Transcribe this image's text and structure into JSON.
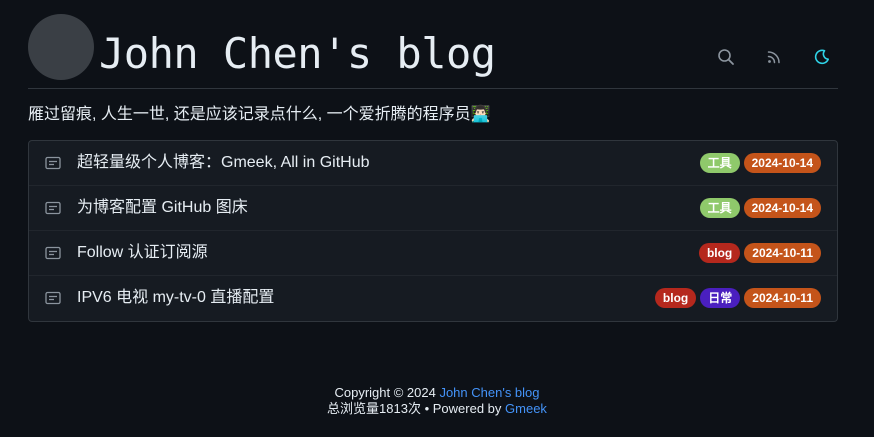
{
  "header": {
    "title": "John Chen's blog",
    "icons": [
      {
        "name": "search-icon",
        "color": "#8b949e"
      },
      {
        "name": "rss-icon",
        "color": "#8b949e"
      },
      {
        "name": "moon-icon",
        "color": "#2fd4e8"
      }
    ]
  },
  "subtitle": "雁过留痕, 人生一世, 还是应该记录点什么, 一个爱折腾的程序员",
  "subtitle_emoji": "👨🏻‍💻",
  "posts": [
    {
      "title": "超轻量级个人博客：Gmeek, All in GitHub",
      "labels": [
        {
          "text": "工具",
          "color": "#8fc96b"
        },
        {
          "text": "2024-10-14",
          "color": "#c4541a"
        }
      ]
    },
    {
      "title": "为博客配置 GitHub 图床",
      "labels": [
        {
          "text": "工具",
          "color": "#8fc96b"
        },
        {
          "text": "2024-10-14",
          "color": "#c4541a"
        }
      ]
    },
    {
      "title": "Follow 认证订阅源",
      "labels": [
        {
          "text": "blog",
          "color": "#b5281d"
        },
        {
          "text": "2024-10-11",
          "color": "#c4541a"
        }
      ]
    },
    {
      "title": "IPV6 电视 my-tv-0 直播配置",
      "labels": [
        {
          "text": "blog",
          "color": "#b5281d"
        },
        {
          "text": "日常",
          "color": "#4a1fbf"
        },
        {
          "text": "2024-10-11",
          "color": "#c4541a"
        }
      ]
    }
  ],
  "footer": {
    "copyright_prefix": "Copyright © 2024",
    "blog_link": "John Chen's blog",
    "views_prefix": "总浏览量1813次 • Powered by",
    "gmeek_link": "Gmeek"
  }
}
